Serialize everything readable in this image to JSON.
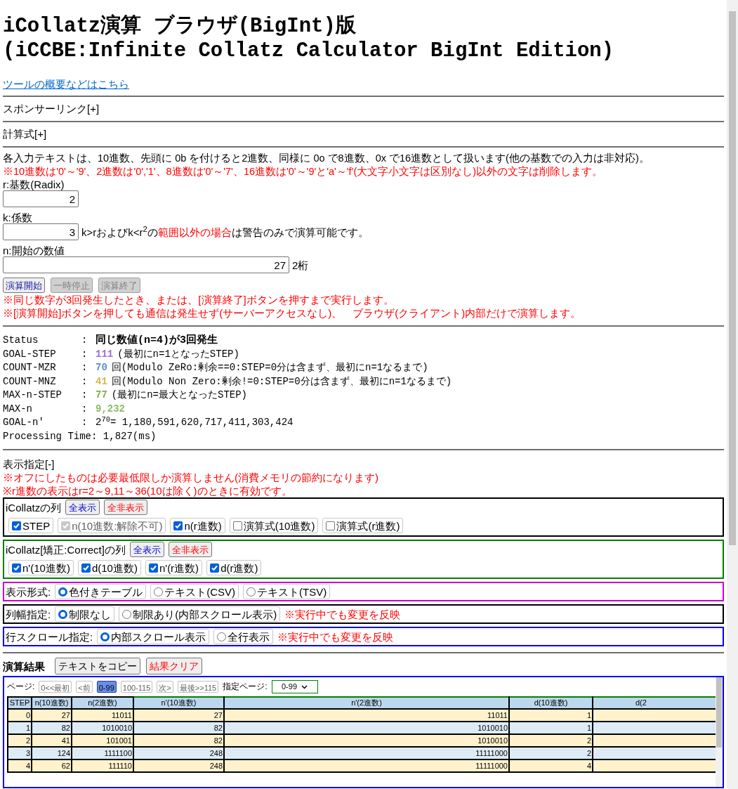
{
  "title_lines": [
    "iCollatz演算 ブラウザ(BigInt)版",
    "(iCCBE:Infinite Collatz Calculator BigInt Edition)"
  ],
  "overview_link": "ツールの概要などはこちら",
  "collapsed_sections": [
    "スポンサーリンク[+]",
    "計算式[+]"
  ],
  "input_note": "各入力テキストは、10進数、先頭に 0b を付けると2進数、同様に 0o で8進数、0x で16進数として扱います(他の基数での入力は非対応)。",
  "input_warning": "※10進数は'0'～'9'、2進数は'0','1'、8進数は'0'～'7'、16進数は'0'～'9'と'a'～'f'(大文字小文字は区別なし)以外の文字は削除します。",
  "inputs": {
    "radix": {
      "label": "r:基数(Radix)",
      "value": "2",
      "kind": "short"
    },
    "coefficient": {
      "label": "k:係数",
      "value": "3",
      "kind": "short",
      "note": [
        {
          "text": "k>rおよびk<r$^{2}$の",
          "red": false
        },
        {
          "text": "範囲以外の場合",
          "red": true
        },
        {
          "text": "は警告のみで演算可能です。",
          "red": false
        }
      ]
    },
    "start": {
      "label": "n:開始の数値",
      "value": "27",
      "kind": "long",
      "note": [
        {
          "text": "2桁",
          "red": false
        }
      ]
    }
  },
  "run_buttons": [
    {
      "label": "演算開始",
      "disabled": false
    },
    {
      "label": "一時停止",
      "disabled": true
    },
    {
      "label": "演算終了",
      "disabled": true
    }
  ],
  "run_notes": [
    "※同じ数字が3回発生したとき、または、[演算終了]ボタンを押すまで実行します。",
    "※[演算開始]ボタンを押しても通信は発生せず(サーバーアクセスなし)、　ブラウザ(クライアント)内部だけで演算します。"
  ],
  "status": [
    {
      "key": "Status",
      "sep": ":",
      "value": "同じ数値(n=4)が3回発生",
      "kind": "bold"
    },
    {
      "key": "GOAL-STEP",
      "sep": ":",
      "value": "111",
      "kind": "colored",
      "color": "#9b6fd8",
      "note": "(最初にn=1となったSTEP)"
    },
    {
      "key": "COUNT-MZR",
      "sep": ":",
      "value": "70",
      "kind": "colored",
      "color": "#5b8fd0",
      "note": "回(Modulo ZeRo:剰余==0:STEP=0分は含まず、最初にn=1なるまで)"
    },
    {
      "key": "COUNT-MNZ",
      "sep": ":",
      "value": "41",
      "kind": "colored",
      "color": "#d9b84a",
      "note": "回(Modulo Non Zero:剰余!=0:STEP=0分は含まず、最初にn=1なるまで)"
    },
    {
      "key": "MAX-n-STEP",
      "sep": ":",
      "value": "77",
      "kind": "colored",
      "color": "#7fae4a",
      "note": "(最初にn=最大となったSTEP)"
    },
    {
      "key": "MAX-n",
      "sep": ":",
      "value": "9,232",
      "kind": "colored",
      "color": "#8fb86a"
    },
    {
      "key": "GOAL-n'",
      "sep": ":",
      "value": "2$^{70}$= 1,180,591,620,717,411,303,424",
      "kind": "plain"
    }
  ],
  "processing_time": "Processing Time: 1,827(ms)",
  "display": {
    "header": "表示指定[-]",
    "notes": [
      "※オフにしたものは必要最低限しか演算しません(消費メモリの節約になります)",
      "※r進数の表示はr=2～9,11～36(10は除く)のときに有効です。"
    ],
    "groups": [
      {
        "label": "iCollatzの列",
        "color": "#000000",
        "buttons": [
          {
            "label": "全表示",
            "kind": "accent"
          },
          {
            "label": "全非表示",
            "kind": "danger"
          }
        ],
        "options": [
          {
            "label": "STEP",
            "kind": "checkbox",
            "checked": true,
            "disabled": false
          },
          {
            "label": "n(10進数:解除不可)",
            "kind": "checkbox",
            "checked": true,
            "disabled": true
          },
          {
            "label": "n(r進数)",
            "kind": "checkbox",
            "checked": true,
            "disabled": false
          },
          {
            "label": "演算式(10進数)",
            "kind": "checkbox",
            "checked": false,
            "disabled": false
          },
          {
            "label": "演算式(r進数)",
            "kind": "checkbox",
            "checked": false,
            "disabled": false
          }
        ]
      },
      {
        "label": "iCollatz[矯正:Correct]の列",
        "color": "#008000",
        "buttons": [
          {
            "label": "全表示",
            "kind": "accent"
          },
          {
            "label": "全非表示",
            "kind": "danger"
          }
        ],
        "options": [
          {
            "label": "n'(10進数)",
            "kind": "checkbox",
            "checked": true,
            "disabled": false
          },
          {
            "label": "d(10進数)",
            "kind": "checkbox",
            "checked": true,
            "disabled": false
          },
          {
            "label": "n'(r進数)",
            "kind": "checkbox",
            "checked": true,
            "disabled": false
          },
          {
            "label": "d(r進数)",
            "kind": "checkbox",
            "checked": true,
            "disabled": false
          }
        ]
      },
      {
        "label": "表示形式:",
        "color": "#cc00cc",
        "options": [
          {
            "label": "色付きテーブル",
            "kind": "radio",
            "checked": true,
            "disabled": false
          },
          {
            "label": "テキスト(CSV)",
            "kind": "radio",
            "checked": false,
            "disabled": false
          },
          {
            "label": "テキスト(TSV)",
            "kind": "radio",
            "checked": false,
            "disabled": false
          }
        ]
      },
      {
        "label": "列幅指定:",
        "color": "#000000",
        "options": [
          {
            "label": "制限なし",
            "kind": "radio",
            "checked": true,
            "disabled": false
          },
          {
            "label": "制限あり(内部スクロール表示)",
            "kind": "radio",
            "checked": false,
            "disabled": false
          }
        ],
        "note": "※実行中でも変更を反映"
      },
      {
        "label": "行スクロール指定:",
        "color": "#0000ff",
        "options": [
          {
            "label": "内部スクロール表示",
            "kind": "radio",
            "checked": true,
            "disabled": false
          },
          {
            "label": "全行表示",
            "kind": "radio",
            "checked": false,
            "disabled": false
          }
        ],
        "note": "※実行中でも変更を反映"
      }
    ]
  },
  "results": {
    "title": "演算結果",
    "buttons": [
      {
        "label": "テキストをコピー",
        "kind": "plain"
      },
      {
        "label": "結果クリア",
        "kind": "danger"
      }
    ],
    "page_label": "ページ:",
    "pages": [
      {
        "label": "0<<最初",
        "selected": false
      },
      {
        "label": "<前",
        "selected": false
      },
      {
        "label": "0-99",
        "selected": true
      },
      {
        "label": "100-115",
        "selected": false
      },
      {
        "label": "次>",
        "selected": false
      },
      {
        "label": "最後>>115",
        "selected": false
      }
    ],
    "page_select_label": "指定ページ:",
    "page_select": "0-99",
    "table": {
      "columns": [
        {
          "label": "STEP",
          "color": "#000000"
        },
        {
          "label": "n(10進数)",
          "color": "#000000"
        },
        {
          "label": "n(2進数)",
          "color": "#000000"
        },
        {
          "label": "n'(10進数)",
          "color": "#008000"
        },
        {
          "label": "n'(2進数)",
          "color": "#008000"
        },
        {
          "label": "d(10進数)",
          "color": "#008000"
        },
        {
          "label": "d(2",
          "color": "#008000"
        }
      ],
      "rows": [
        [
          "0",
          "27",
          "11011",
          "27",
          "11011",
          "1"
        ],
        [
          "1",
          "82",
          "1010010",
          "82",
          "1010010",
          "1"
        ],
        [
          "2",
          "41",
          "101001",
          "82",
          "1010010",
          "2"
        ],
        [
          "3",
          "124",
          "1111100",
          "248",
          "11111000",
          "2"
        ],
        [
          "4",
          "62",
          "111110",
          "248",
          "11111000",
          "4"
        ]
      ]
    }
  }
}
